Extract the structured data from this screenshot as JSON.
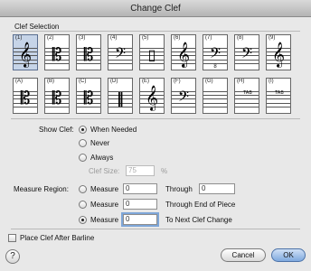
{
  "window": {
    "title": "Change Clef"
  },
  "clef_selection": {
    "label": "Clef Selection",
    "row1": [
      {
        "num": "(1)",
        "glyph": "𝄞",
        "selected": true
      },
      {
        "num": "(2)",
        "glyph": "𝄡"
      },
      {
        "num": "(3)",
        "glyph": "𝄡"
      },
      {
        "num": "(4)",
        "glyph": "𝄢"
      },
      {
        "num": "(5)",
        "glyph": "▯"
      },
      {
        "num": "(6)",
        "glyph": "𝄞",
        "sub": "8"
      },
      {
        "num": "(7)",
        "glyph": "𝄢",
        "sub": "8"
      },
      {
        "num": "(8)",
        "glyph": "𝄢"
      },
      {
        "num": "(9)",
        "glyph": "𝄞"
      }
    ],
    "row2": [
      {
        "num": "(A)",
        "glyph": "𝄡"
      },
      {
        "num": "(B)",
        "glyph": "𝄡"
      },
      {
        "num": "(C)",
        "glyph": "𝄡"
      },
      {
        "num": "(D)",
        "glyph": "‖"
      },
      {
        "num": "(E)",
        "glyph": "𝄞"
      },
      {
        "num": "(F)",
        "glyph": "𝄢"
      },
      {
        "num": "(G)",
        "glyph": ""
      },
      {
        "num": "(H)",
        "glyph": "TAB"
      },
      {
        "num": "(I)",
        "glyph": "TAB"
      }
    ]
  },
  "show_clef": {
    "label": "Show Clef:",
    "options": [
      "When Needed",
      "Never",
      "Always"
    ],
    "selected": "When Needed",
    "clef_size_label": "Clef Size:",
    "clef_size_value": "75",
    "clef_size_unit": "%"
  },
  "measure_region": {
    "label": "Measure Region:",
    "row1": {
      "option": "Measure",
      "value": "0",
      "through": "Through",
      "through_value": "0"
    },
    "row2": {
      "option": "Measure",
      "value": "0",
      "through": "Through End of Piece"
    },
    "row3": {
      "option": "Measure",
      "value": "0",
      "through": "To Next Clef Change",
      "selected": true
    }
  },
  "place_clef": {
    "label": "Place Clef After Barline",
    "checked": false
  },
  "buttons": {
    "help": "?",
    "cancel": "Cancel",
    "ok": "OK"
  }
}
